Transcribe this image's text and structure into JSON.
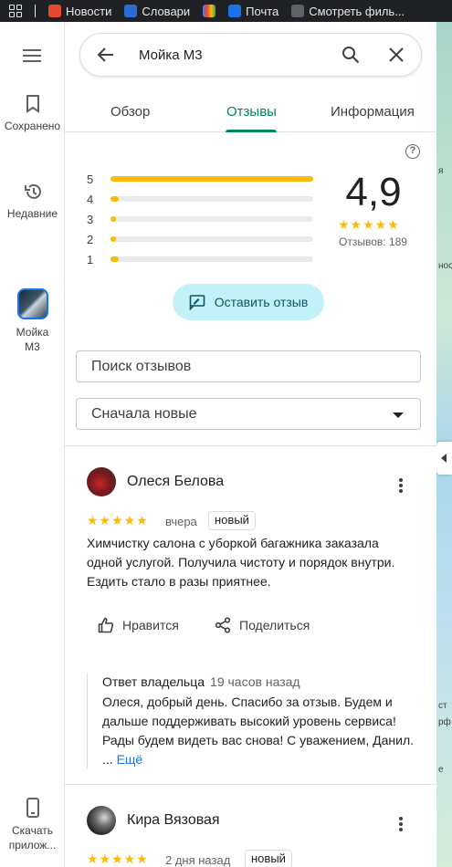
{
  "bookmarks": [
    "Новости",
    "Словари",
    "Почта",
    "Смотреть филь..."
  ],
  "rail": {
    "saved_label": "Сохранено",
    "recent_label": "Недавние",
    "place_label": "Мойка М3",
    "install_label": "Скачать прилож..."
  },
  "search": {
    "query": "Мойка М3"
  },
  "tabs": [
    {
      "label": "Обзор",
      "active": false
    },
    {
      "label": "Отзывы",
      "active": true
    },
    {
      "label": "Информация",
      "active": false
    }
  ],
  "summary": {
    "rating": "4,9",
    "count_label": "Отзывов: 189",
    "stars": "★★★★★",
    "distribution": [
      {
        "stars": "5",
        "fraction": 1.0
      },
      {
        "stars": "4",
        "fraction": 0.04
      },
      {
        "stars": "3",
        "fraction": 0.01
      },
      {
        "stars": "2",
        "fraction": 0.01
      },
      {
        "stars": "1",
        "fraction": 0.04
      }
    ],
    "help_symbol": "?"
  },
  "write_review_label": "Оставить отзыв",
  "review_search_placeholder": "Поиск отзывов",
  "sort_label": "Сначала новые",
  "reviews": [
    {
      "author": "Олеся Белова",
      "stars": "★★★★★",
      "date": "вчера",
      "badge": "новый",
      "text": "Химчистку салона с уборкой багажника заказала одной услугой. Получила чистоту и порядок внутри. Ездить стало в разы приятнее.",
      "like_label": "Нравится",
      "share_label": "Поделиться",
      "owner_reply": {
        "title": "Ответ владельца",
        "time": "19 часов назад",
        "text": "Олеся, добрый день. Спасибо за отзыв. Будем и дальше поддерживать высокий уровень сервиса! Рады будем видеть вас снова! С уважением, Данил. ...",
        "more_label": "Ещё"
      }
    },
    {
      "author": "Кира Вязовая",
      "stars": "★★★★★",
      "date": "2 дня назад",
      "badge": "новый"
    }
  ],
  "map_labels": [
    "я",
    "нос",
    "ст",
    "рф",
    "е"
  ],
  "colors": {
    "accent": "#01875f",
    "star": "#fbbc04",
    "write_btn_bg": "#c2f1f7",
    "link": "#1a73e8"
  }
}
